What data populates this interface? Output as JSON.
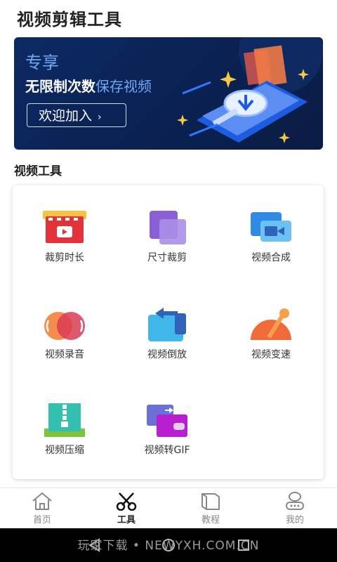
{
  "header": {
    "title": "视频剪辑工具"
  },
  "banner": {
    "exclusive": "专享",
    "line_main": "无限制次数",
    "line_highlight": "保存视频",
    "join_label": "欢迎加入",
    "join_chevron": "›",
    "colors": {
      "bg": "#0c2a63",
      "accent": "#6fa8f5",
      "phone": "#1d5ce0",
      "star": "#f5c842"
    }
  },
  "section": {
    "title": "视频工具"
  },
  "tools": [
    {
      "label": "裁剪时长",
      "icon": "film-clip-icon"
    },
    {
      "label": "尺寸裁剪",
      "icon": "resize-squares-icon"
    },
    {
      "label": "视频合成",
      "icon": "video-camera-icon"
    },
    {
      "label": "视频录音",
      "icon": "record-audio-icon"
    },
    {
      "label": "视频倒放",
      "icon": "reverse-arrow-icon"
    },
    {
      "label": "视频变速",
      "icon": "speed-gauge-icon"
    },
    {
      "label": "视频压缩",
      "icon": "zip-compress-icon"
    },
    {
      "label": "视频转GIF",
      "icon": "convert-gif-icon"
    }
  ],
  "nav": [
    {
      "label": "首页",
      "icon": "home-icon",
      "active": false
    },
    {
      "label": "工具",
      "icon": "scissors-icon",
      "active": true
    },
    {
      "label": "教程",
      "icon": "book-icon",
      "active": false
    },
    {
      "label": "我的",
      "icon": "profile-icon",
      "active": false
    }
  ],
  "watermark": "玩家下载 • NEWYXH.COM.CN"
}
